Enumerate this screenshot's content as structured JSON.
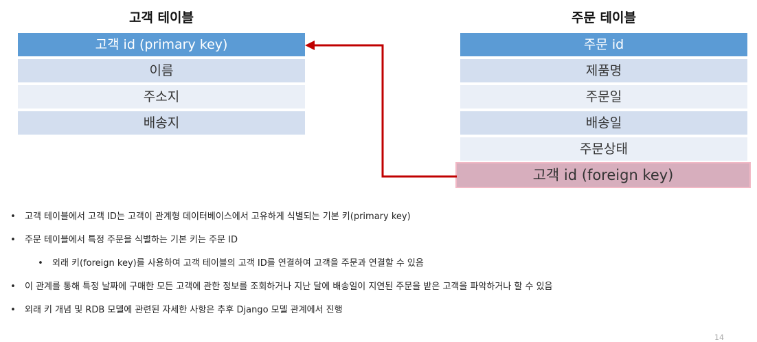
{
  "customer_table": {
    "title": "고객 테이블",
    "rows": [
      "고객 id (primary key)",
      "이름",
      "주소지",
      "배송지"
    ]
  },
  "order_table": {
    "title": "주문 테이블",
    "rows": [
      "주문 id",
      "제품명",
      "주문일",
      "배송일",
      "주문상태",
      "고객 id (foreign key)"
    ]
  },
  "colors": {
    "header_blue": "#5b9bd5",
    "band_a": "#d3deef",
    "band_b": "#eaeff7",
    "foreign_key_fill": "#d7aebd",
    "arrow_red": "#c00000"
  },
  "bullets": [
    "고객 테이블에서 고객 ID는 고객이 관계형 데이터베이스에서 고유하게 식별되는 기본 키(primary key)",
    "주문 테이블에서 특정 주문을 식별하는 기본 키는 주문 ID",
    "외래 키(foreign key)를 사용하여 고객 테이블의 고객 ID를 연결하여 고객을 주문과 연결할 수 있음",
    "이 관계를 통해 특정 날짜에 구매한 모든 고객에 관한 정보를 조회하거나 지난 달에 배송일이 지연된 주문을 받은 고객을 파악하거나 할 수 있음",
    "외래 키 개념 및 RDB 모델에 관련된 자세한 사항은 추후 Django 모델 관계에서 진행"
  ],
  "page_number": "14"
}
